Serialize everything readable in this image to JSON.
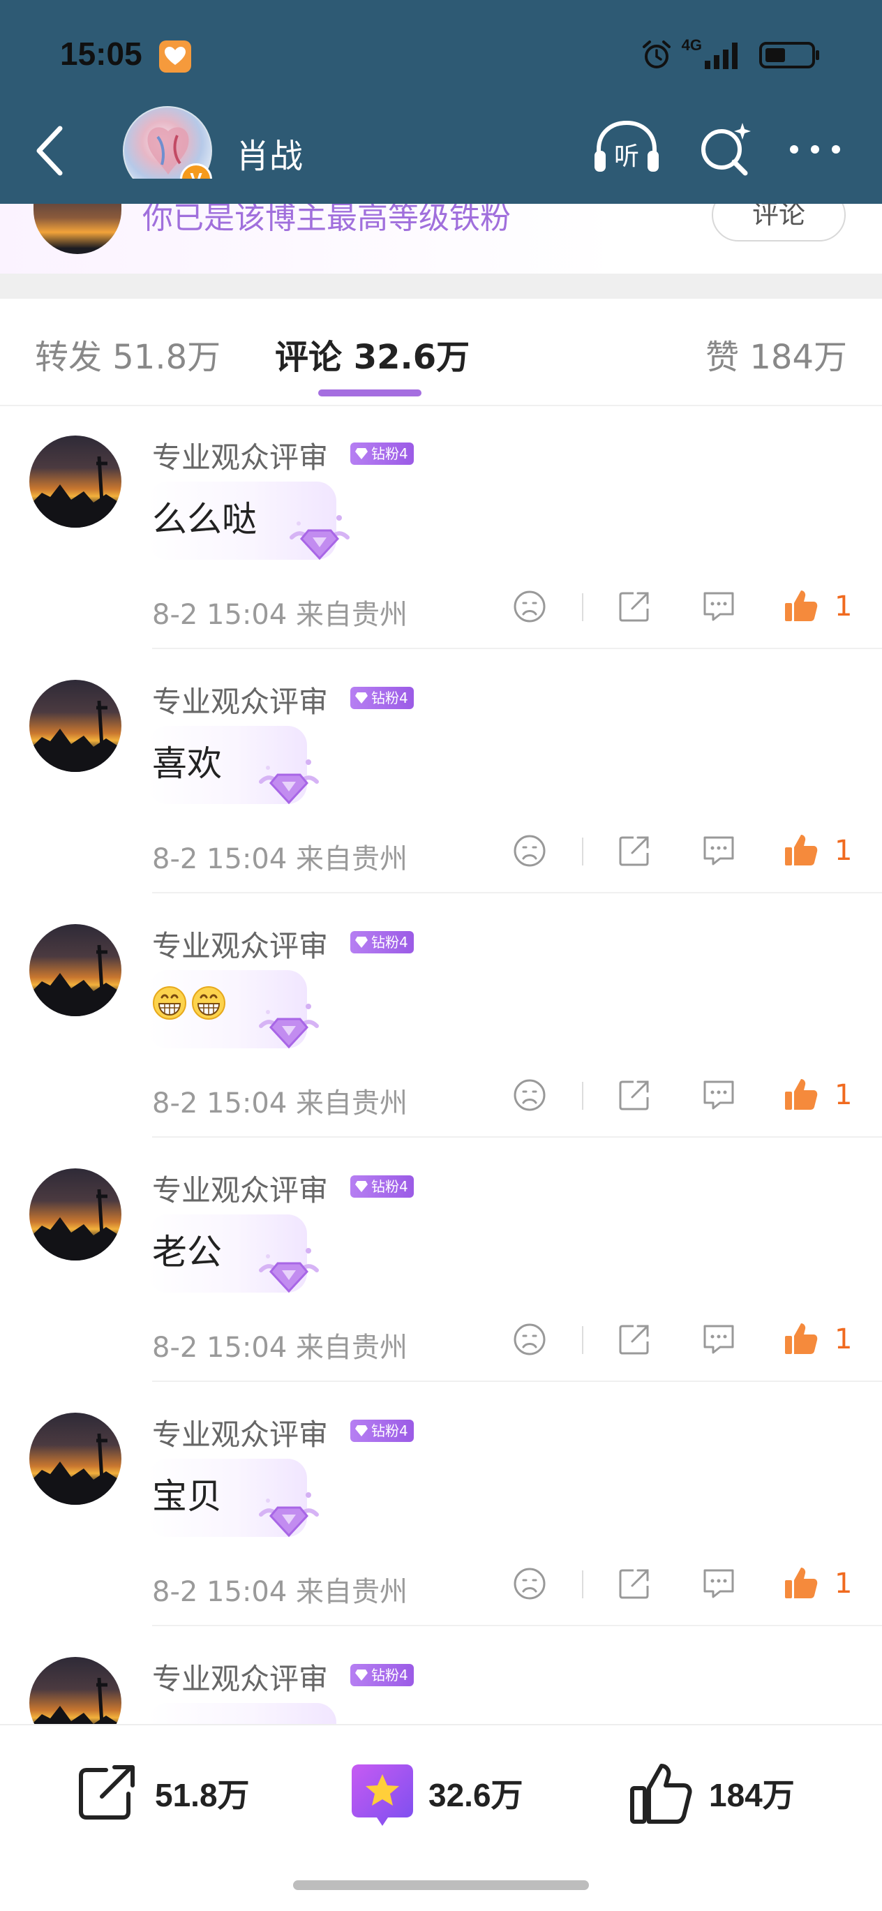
{
  "status_bar": {
    "time": "15:05",
    "network": "4G"
  },
  "header": {
    "title": "肖战",
    "listen_label": "听",
    "verified_mark": "V"
  },
  "fan_banner": {
    "text": "你已是该博主最高等级铁粉",
    "button": "评论"
  },
  "tabs": {
    "repost": "转发 51.8万",
    "comments": "评论 32.6万",
    "likes": "赞 184万"
  },
  "comments": [
    {
      "user": "专业观众评审",
      "badge": "钻粉4",
      "text": "么么哒",
      "time": "8-2 15:04  来自贵州",
      "likes": "1"
    },
    {
      "user": "专业观众评审",
      "badge": "钻粉4",
      "text": "喜欢",
      "time": "8-2 15:04  来自贵州",
      "likes": "1"
    },
    {
      "user": "专业观众评审",
      "badge": "钻粉4",
      "text": "",
      "emojis": [
        "grin-emoji",
        "grin-emoji"
      ],
      "time": "8-2 15:04  来自贵州",
      "likes": "1"
    },
    {
      "user": "专业观众评审",
      "badge": "钻粉4",
      "text": "老公",
      "time": "8-2 15:04  来自贵州",
      "likes": "1"
    },
    {
      "user": "专业观众评审",
      "badge": "钻粉4",
      "text": "宝贝",
      "time": "8-2 15:04  来自贵州",
      "likes": "1"
    },
    {
      "user": "专业观众评审",
      "badge": "钻粉4"
    }
  ],
  "bottom_bar": {
    "repost_count": "51.8万",
    "comment_count": "32.6万",
    "like_count": "184万"
  },
  "colors": {
    "header_bg": "#2e5a74",
    "accent_purple": "#a56ee0",
    "like_orange": "#f06a1f"
  }
}
